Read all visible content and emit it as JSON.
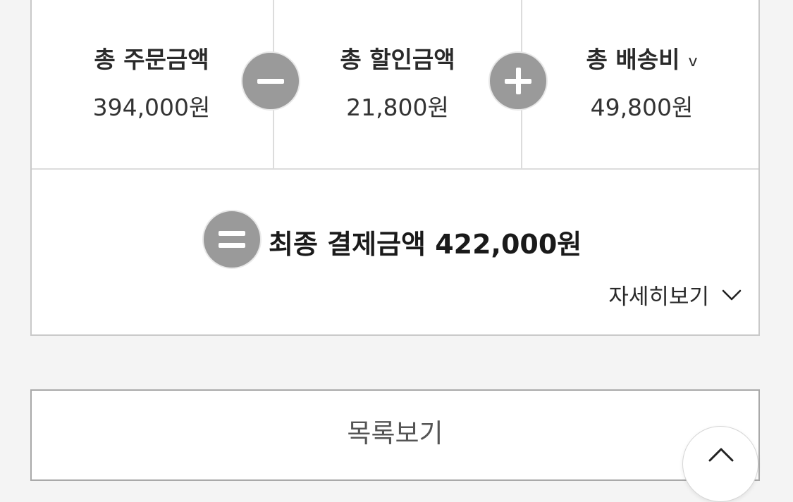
{
  "summary": {
    "order_total_label": "총 주문금액",
    "order_total_value": "394,000원",
    "discount_total_label": "총 할인금액",
    "discount_total_value": "21,800원",
    "shipping_total_label": "총 배송비",
    "shipping_toggle_glyph": "v",
    "shipping_total_value": "49,800원",
    "final_text": "최종 결제금액 422,000원",
    "detail_label": "자세히보기"
  },
  "footer": {
    "list_button_label": "목록보기"
  },
  "icons": {
    "minus": "minus-circle-icon",
    "plus": "plus-circle-icon",
    "equals": "equals-circle-icon",
    "detail_chevron": "chevron-down-icon",
    "scroll_top": "arrow-up-icon"
  },
  "colors": {
    "operator_circle": "#9a9a9a",
    "border": "#c9c9c9",
    "background": "#f4f4f4"
  }
}
